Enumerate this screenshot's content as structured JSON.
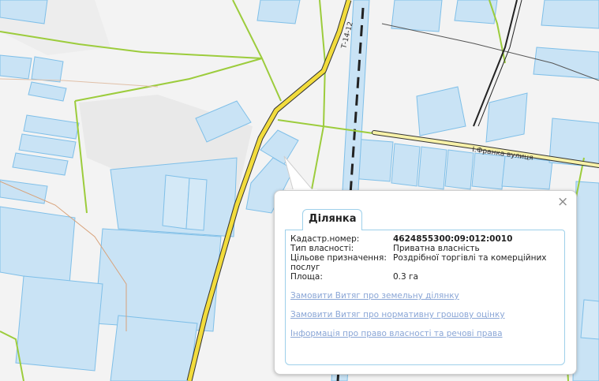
{
  "map": {
    "road_label_highway": "Т-14-12",
    "road_label_street": "І.Франка вулиця"
  },
  "popup": {
    "close_symbol": "×",
    "tab_label": "Ділянка",
    "rows": [
      {
        "key": "Кадастр.номер:",
        "value": "4624855300:09:012:0010",
        "bold": true
      },
      {
        "key": "Тип власності:",
        "value": "Приватна власність",
        "bold": false
      },
      {
        "key": "Цільове призначення:",
        "value": "Роздрібної торгівлі та комерційних",
        "bold": false
      }
    ],
    "purpose_continuation": "послуг",
    "area_key": "Площа:",
    "area_value": "0.3 га",
    "links": [
      "Замовити Витяг про земельну ділянку",
      "Замовити Витяг про нормативну грошову оцінку",
      "Інформація про право власності та речові права"
    ]
  },
  "colors": {
    "parcel_fill": "#c9e3f5",
    "parcel_stroke": "#7fbfe8",
    "boundary_green": "#9ccc3c",
    "road_yellow": "#f2dc3c",
    "link_color": "#8aa6d6"
  },
  "icons": [
    "close-icon"
  ]
}
